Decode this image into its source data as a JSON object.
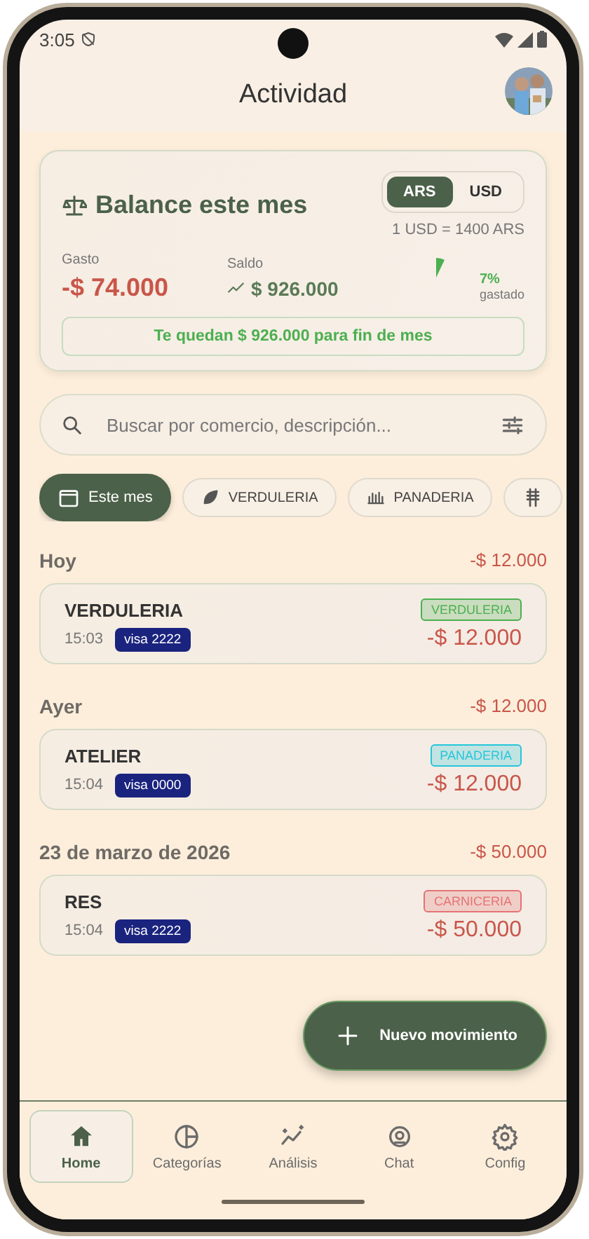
{
  "status_bar": {
    "time": "3:05"
  },
  "header": {
    "title": "Actividad"
  },
  "balance": {
    "title": "Balance este mes",
    "currencies": [
      {
        "label": "ARS",
        "selected": true
      },
      {
        "label": "USD",
        "selected": false
      }
    ],
    "rate": "1 USD = 1400 ARS",
    "spent_label": "Gasto",
    "spent": "-$ 74.000",
    "balance_label": "Saldo",
    "balance": "$ 926.000",
    "gauge": {
      "percent": "7%",
      "caption": "gastado"
    },
    "remaining": "Te quedan $ 926.000 para fin de mes"
  },
  "search": {
    "placeholder": "Buscar por comercio, descripción..."
  },
  "chips": [
    {
      "label": "Este mes",
      "selected": true
    },
    {
      "label": "VERDULERIA",
      "selected": false
    },
    {
      "label": "PANADERIA",
      "selected": false
    },
    {
      "selected": false
    }
  ],
  "groups": [
    {
      "date": "Hoy",
      "total": "-$ 12.000",
      "items": [
        {
          "merchant": "VERDULERIA",
          "time": "15:03",
          "card": "visa 2222",
          "category": "VERDULERIA",
          "color": "#4caf50",
          "amount": "-$ 12.000"
        }
      ]
    },
    {
      "date": "Ayer",
      "total": "-$ 12.000",
      "items": [
        {
          "merchant": "ATELIER",
          "time": "15:04",
          "card": "visa 0000",
          "category": "PANADERIA",
          "color": "#26c6da",
          "amount": "-$ 12.000"
        }
      ]
    },
    {
      "date": "23 de marzo de 2026",
      "total": "-$ 50.000",
      "items": [
        {
          "merchant": "RES",
          "time": "15:04",
          "card": "visa 2222",
          "category": "CARNICERIA",
          "color": "#e57373",
          "amount": "-$ 50.000"
        }
      ]
    }
  ],
  "fab": {
    "label": "Nuevo movimiento"
  },
  "nav": [
    {
      "label": "Home",
      "selected": true
    },
    {
      "label": "Categorías",
      "selected": false
    },
    {
      "label": "Análisis",
      "selected": false
    },
    {
      "label": "Chat",
      "selected": false
    },
    {
      "label": "Config",
      "selected": false
    }
  ]
}
